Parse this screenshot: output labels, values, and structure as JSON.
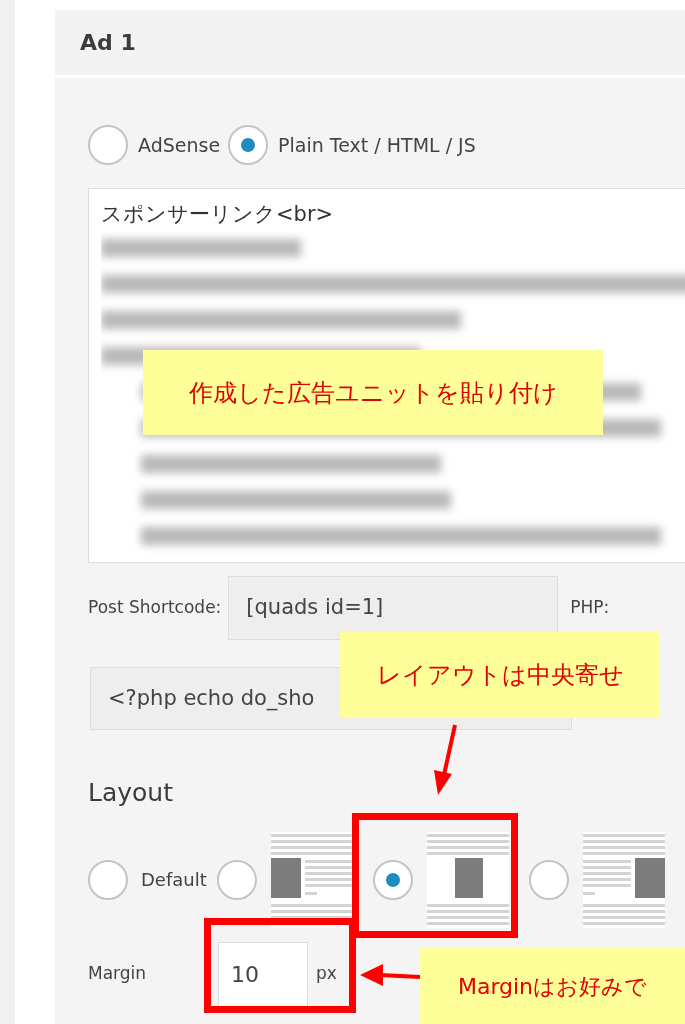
{
  "panel": {
    "title": "Ad 1",
    "ad_types": [
      {
        "label": "AdSense",
        "selected": false
      },
      {
        "label": "Plain Text / HTML / JS",
        "selected": true
      }
    ],
    "code": {
      "value": "スポンサーリンク<br>"
    },
    "post_shortcode": {
      "label": "Post Shortcode:",
      "value": "[quads id=1]"
    },
    "php": {
      "label": "PHP:",
      "value": "<?php echo do_sho"
    },
    "layout": {
      "heading": "Layout",
      "options": [
        {
          "kind": "default",
          "label": "Default",
          "selected": false
        },
        {
          "kind": "left",
          "selected": false
        },
        {
          "kind": "center",
          "selected": true
        },
        {
          "kind": "right",
          "selected": false
        }
      ]
    },
    "margin": {
      "label": "Margin",
      "value": "10",
      "unit": "px"
    }
  },
  "annotations": [
    {
      "text": "作成した広告ユニットを貼り付け"
    },
    {
      "text": "レイアウトは中央寄せ"
    },
    {
      "text": "Marginはお好みで"
    }
  ]
}
